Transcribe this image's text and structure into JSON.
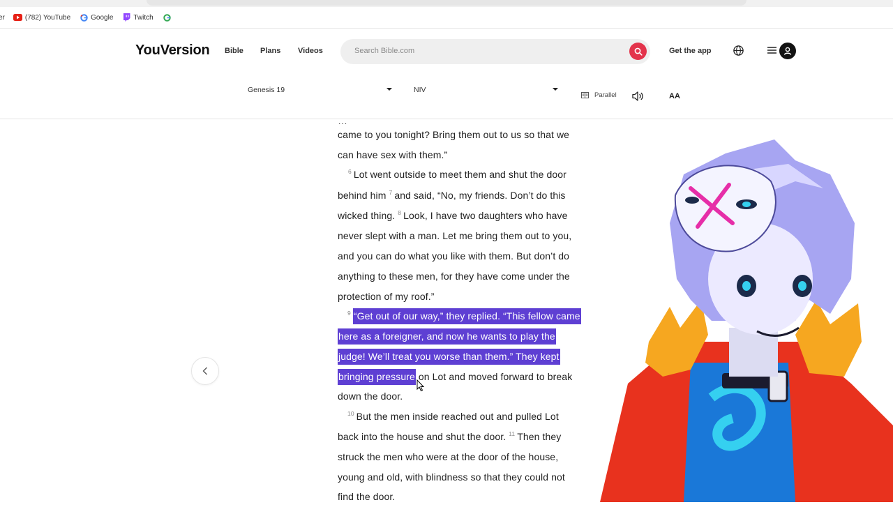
{
  "browser": {
    "bookmarks": [
      {
        "label": "(782) YouTube",
        "icon": "youtube-icon"
      },
      {
        "label": "Google",
        "icon": "google-icon"
      },
      {
        "label": "Twitch",
        "icon": "twitch-icon"
      },
      {
        "label": "",
        "icon": "google-icon"
      }
    ]
  },
  "header": {
    "logo": "YouVersion",
    "nav": [
      "Bible",
      "Plans",
      "Videos"
    ],
    "search_placeholder": "Search Bible.com",
    "get_app": "Get the app"
  },
  "toolbar": {
    "book_chapter": "Genesis 19",
    "version": "NIV",
    "parallel": "Parallel",
    "font_size": "AA"
  },
  "reader": {
    "lines": [
      {
        "text": "came to you tonight? Bring them out to us so that we"
      },
      {
        "text": "can have sex with them.”"
      },
      {
        "text": "Lot went outside to meet them and shut the door"
      },
      {
        "text_a": "behind him ",
        "text_b": "and said, “No, my friends. Don’t do this"
      },
      {
        "text_a": "wicked thing. ",
        "text_b": "Look, I have two daughters who have"
      },
      {
        "text": "never slept with a man. Let me bring them out to you,"
      },
      {
        "text": "and you can do what you like with them. But don’t do"
      },
      {
        "text": "anything to these men, for they have come under the"
      },
      {
        "text": "protection of my roof.”"
      },
      {
        "text": "“Get out of our way,” they replied. “This fellow came"
      },
      {
        "text": "here as a foreigner, and now he wants to play the"
      },
      {
        "text": "judge! We’ll treat you worse than them.” They kept"
      },
      {
        "text_hl": "bringing pressure",
        "text_rest": " on Lot and moved forward to break"
      },
      {
        "text": "down the door."
      },
      {
        "text": "But the men inside reached out and pulled Lot"
      },
      {
        "text_a": "back into the house and shut the door. ",
        "text_b": "Then they"
      },
      {
        "text": "struck the men who were at the door of the house,"
      },
      {
        "text": "young and old, with blindness so that they could not"
      },
      {
        "text": "find the door."
      }
    ],
    "verse_numbers": {
      "v6": "6",
      "v7": "7",
      "v8": "8",
      "v9": "9",
      "v10": "10",
      "v11": "11"
    }
  },
  "colors": {
    "highlight": "#5e3fd3",
    "search_button": "#e3334b"
  }
}
